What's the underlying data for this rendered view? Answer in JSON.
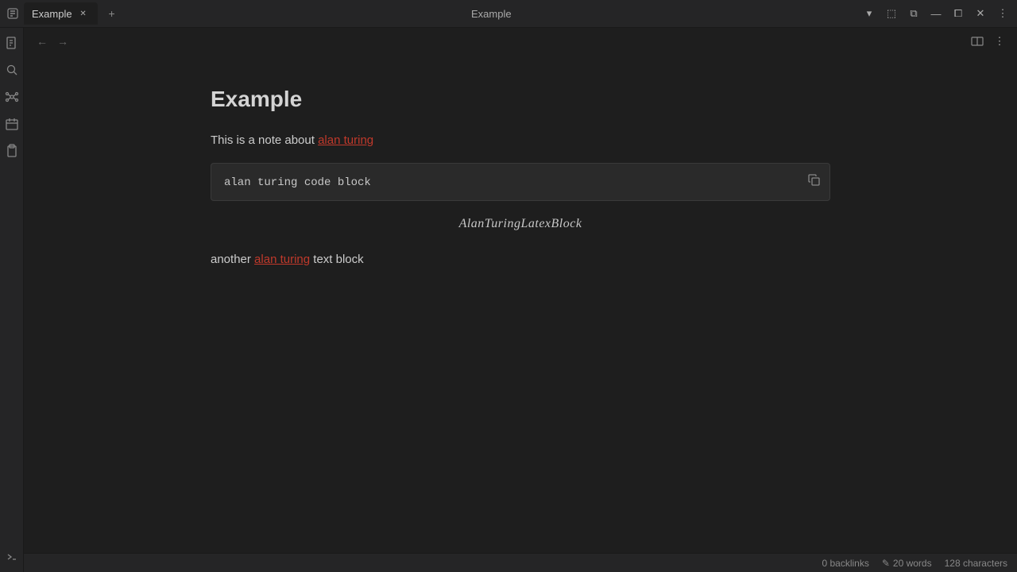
{
  "app": {
    "title": "Example"
  },
  "tabs": [
    {
      "label": "Example",
      "active": true
    }
  ],
  "toolbar": {
    "center_title": "Example",
    "back_label": "←",
    "forward_label": "→",
    "new_tab_label": "+"
  },
  "window_controls": {
    "dropdown": "▾",
    "split": "⧉",
    "minimize": "—",
    "restore": "⧠",
    "close": "✕",
    "more": "⋮",
    "layout": "⬚"
  },
  "sidebar": {
    "icons": [
      {
        "name": "files-icon",
        "symbol": "⎘"
      },
      {
        "name": "search-icon",
        "symbol": "⊕"
      },
      {
        "name": "graph-icon",
        "symbol": "⊞"
      },
      {
        "name": "calendar-icon",
        "symbol": "⊟"
      },
      {
        "name": "clipboard-icon",
        "symbol": "⊡"
      },
      {
        "name": "terminal-icon",
        "symbol": ">"
      }
    ]
  },
  "content": {
    "page_title": "Example",
    "paragraph1_prefix": "This is a note about ",
    "paragraph1_link": "alan turing",
    "code_block_text": "alan turing code block",
    "latex_text": "AlanTuringLatexBlock",
    "paragraph2_prefix": "another ",
    "paragraph2_link": "alan turing",
    "paragraph2_suffix": " text block"
  },
  "status_bar": {
    "backlinks": "0 backlinks",
    "words": "20 words",
    "characters": "128 characters",
    "edit_icon": "✎"
  }
}
